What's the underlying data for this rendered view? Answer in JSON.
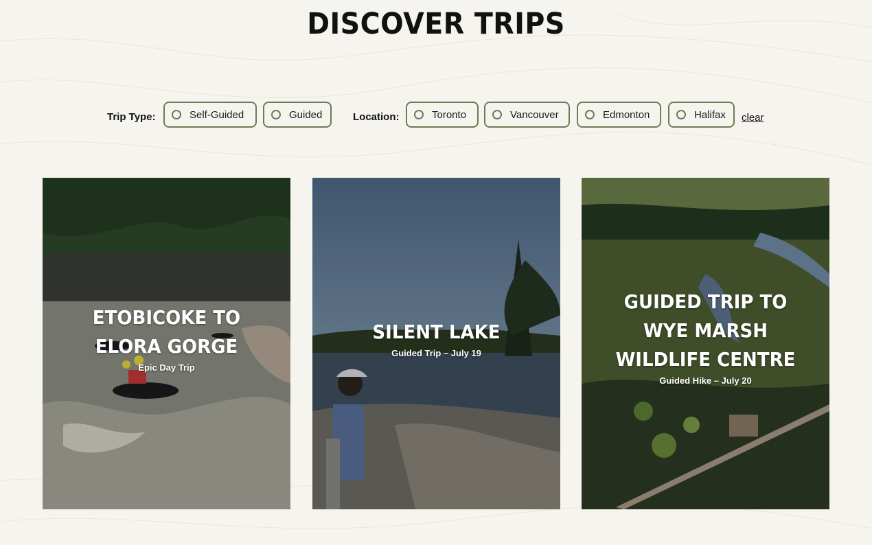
{
  "page": {
    "title": "DISCOVER TRIPS"
  },
  "filters": {
    "trip_type_label": "Trip Type:",
    "trip_types": [
      "Self-Guided",
      "Guided"
    ],
    "location_label": "Location:",
    "locations": [
      "Toronto",
      "Vancouver",
      "Edmonton",
      "Halifax"
    ],
    "clear_label": "clear"
  },
  "trips": [
    {
      "title": "ETOBICOKE TO ELORA GORGE",
      "subtitle": "Epic Day Trip"
    },
    {
      "title": "SILENT LAKE",
      "subtitle": "Guided Trip – July 19"
    },
    {
      "title": "GUIDED TRIP TO WYE MARSH WILDLIFE CENTRE",
      "subtitle": "Guided Hike – July 20"
    }
  ],
  "colors": {
    "background": "#f6f4ee",
    "chip_border": "#6a7d54",
    "text": "#111111"
  }
}
